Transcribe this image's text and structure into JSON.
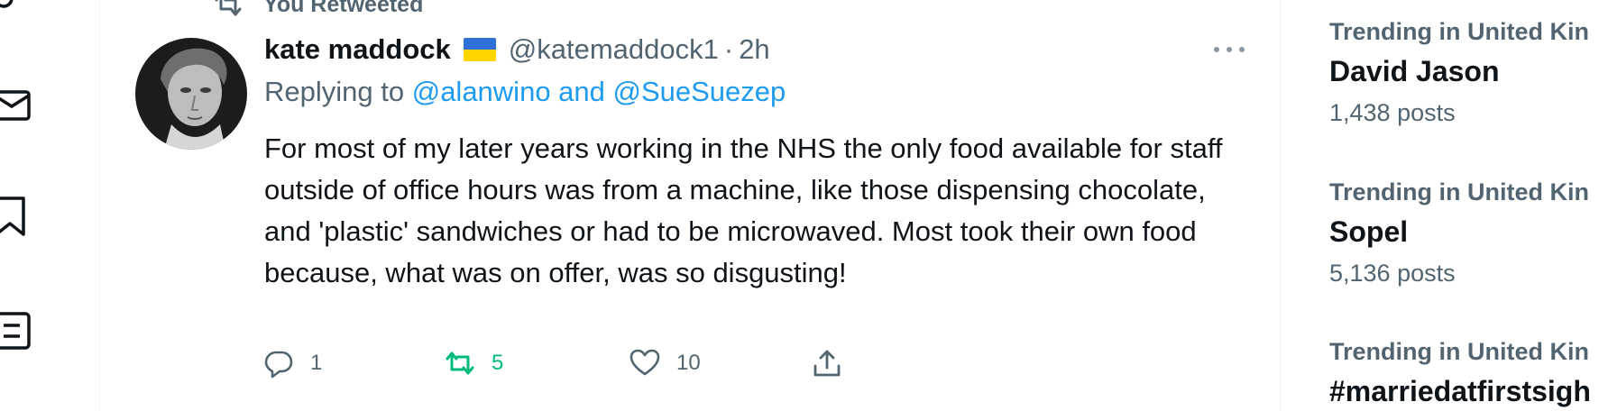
{
  "retweet_header": {
    "label": "You Retweeted"
  },
  "tweet": {
    "author_name": "kate maddock",
    "handle": "@katemaddock1",
    "separator": "·",
    "time": "2h",
    "reply_prefix": "Replying to",
    "reply_targets": "@alanwino and @SueSuezep",
    "text": "For most of my later years working in the NHS the only food available for staff outside of office hours was from a machine, like those dispensing chocolate, and 'plastic' sandwiches or had to be microwaved. Most took their own food because, what was on offer, was so disgusting!",
    "replies": "1",
    "retweets": "5",
    "likes": "10"
  },
  "trends": [
    {
      "context": "Trending in United Kin",
      "name": "David Jason",
      "count": "1,438 posts"
    },
    {
      "context": "Trending in United Kin",
      "name": "Sopel",
      "count": "5,136 posts"
    },
    {
      "context": "Trending in United Kin",
      "name": "#marriedatfirstsigh"
    }
  ],
  "icons": {
    "nav": [
      "notification-icon",
      "messages-icon",
      "bookmarks-icon",
      "lists-icon"
    ],
    "retweet_color": "#00ba7c",
    "link_color": "#1d9bf0",
    "muted_color": "#536471"
  }
}
